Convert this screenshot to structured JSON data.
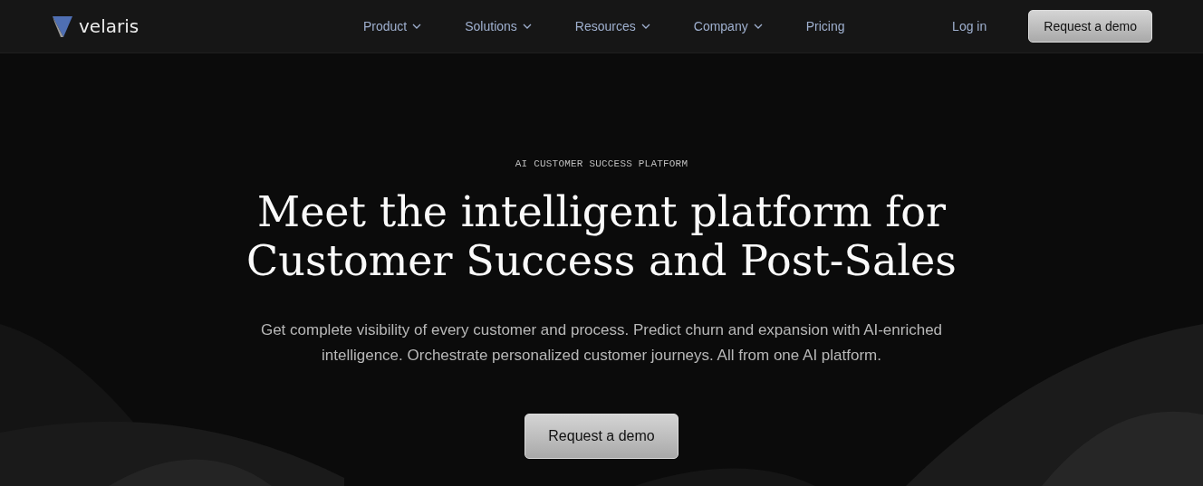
{
  "brand": {
    "name": "velaris"
  },
  "nav": {
    "items": [
      {
        "label": "Product",
        "has_dropdown": true
      },
      {
        "label": "Solutions",
        "has_dropdown": true
      },
      {
        "label": "Resources",
        "has_dropdown": true
      },
      {
        "label": "Company",
        "has_dropdown": true
      },
      {
        "label": "Pricing",
        "has_dropdown": false
      }
    ],
    "login": "Log in",
    "cta": "Request a demo"
  },
  "hero": {
    "eyebrow": "AI CUSTOMER SUCCESS PLATFORM",
    "headline": [
      "Meet the intelligent platform for",
      "Customer Success and Post-Sales"
    ],
    "description": "Get complete visibility of every customer and process. Predict churn and expansion with AI-enriched intelligence. Orchestrate personalized customer journeys. All from one AI platform.",
    "cta": "Request a demo"
  }
}
